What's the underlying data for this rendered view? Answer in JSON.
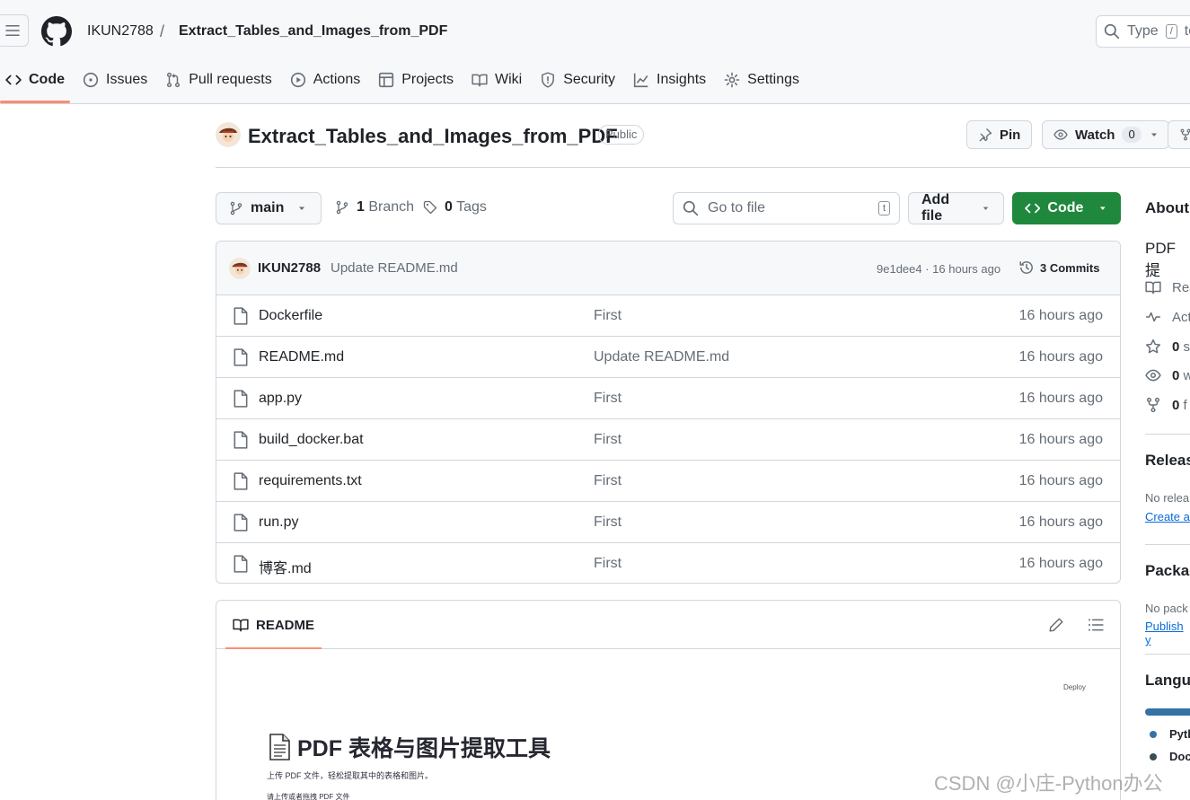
{
  "header": {
    "owner": "IKUN2788",
    "separator": "/",
    "repo": "Extract_Tables_and_Images_from_PDF",
    "search_placeholder": "Type",
    "search_key": "/",
    "search_suffix": "to"
  },
  "tabs": [
    {
      "label": "Code",
      "icon": "code-icon",
      "active": true
    },
    {
      "label": "Issues",
      "icon": "issue-icon"
    },
    {
      "label": "Pull requests",
      "icon": "pull-request-icon"
    },
    {
      "label": "Actions",
      "icon": "play-icon"
    },
    {
      "label": "Projects",
      "icon": "table-icon"
    },
    {
      "label": "Wiki",
      "icon": "book-icon"
    },
    {
      "label": "Security",
      "icon": "shield-icon"
    },
    {
      "label": "Insights",
      "icon": "graph-icon"
    },
    {
      "label": "Settings",
      "icon": "gear-icon"
    }
  ],
  "repo": {
    "title": "Extract_Tables_and_Images_from_PDF",
    "visibility": "Public",
    "pin_label": "Pin",
    "watch_label": "Watch",
    "watch_count": "0"
  },
  "toolbar": {
    "branch": "main",
    "branches_count": "1",
    "branches_label": "Branch",
    "tags_count": "0",
    "tags_label": "Tags",
    "goto_placeholder": "Go to file",
    "goto_key": "t",
    "add_file": "Add file",
    "code": "Code"
  },
  "latest_commit": {
    "author": "IKUN2788",
    "message": "Update README.md",
    "sha_time": "9e1dee4 · 16 hours ago",
    "commits": "3 Commits"
  },
  "files": [
    {
      "name": "Dockerfile",
      "message": "First",
      "time": "16 hours ago"
    },
    {
      "name": "README.md",
      "message": "Update README.md",
      "time": "16 hours ago"
    },
    {
      "name": "app.py",
      "message": "First",
      "time": "16 hours ago"
    },
    {
      "name": "build_docker.bat",
      "message": "First",
      "time": "16 hours ago"
    },
    {
      "name": "requirements.txt",
      "message": "First",
      "time": "16 hours ago"
    },
    {
      "name": "run.py",
      "message": "First",
      "time": "16 hours ago"
    },
    {
      "name": "博客.md",
      "message": "First",
      "time": "16 hours ago"
    }
  ],
  "readme": {
    "tab": "README",
    "deploy": "Deploy",
    "title": "PDF 表格与图片提取工具",
    "subtitle": "上传 PDF 文件，轻松提取其中的表格和图片。",
    "upload_hint": "请上传或者拖拽 PDF 文件"
  },
  "sidebar": {
    "about": "About",
    "description": "PDF提",
    "items": [
      {
        "icon": "book-icon",
        "count": "",
        "label": "Rea"
      },
      {
        "icon": "pulse-icon",
        "count": "",
        "label": "Act"
      },
      {
        "icon": "star-icon",
        "count": "0",
        "label": "s"
      },
      {
        "icon": "eye-icon",
        "count": "0",
        "label": "w"
      },
      {
        "icon": "fork-icon",
        "count": "0",
        "label": "f"
      }
    ],
    "releases_title": "Releas",
    "releases_text": "No relea",
    "releases_link": "Create a",
    "packages_title": "Packag",
    "packages_text": "No pack",
    "packages_link": "Publish y",
    "languages_title": "Langu",
    "languages": [
      {
        "name": "Pyth",
        "color": "#3572a5"
      },
      {
        "name": "Doc",
        "color": "#384d54"
      }
    ]
  },
  "watermark": "CSDN @小庄-Python办公"
}
